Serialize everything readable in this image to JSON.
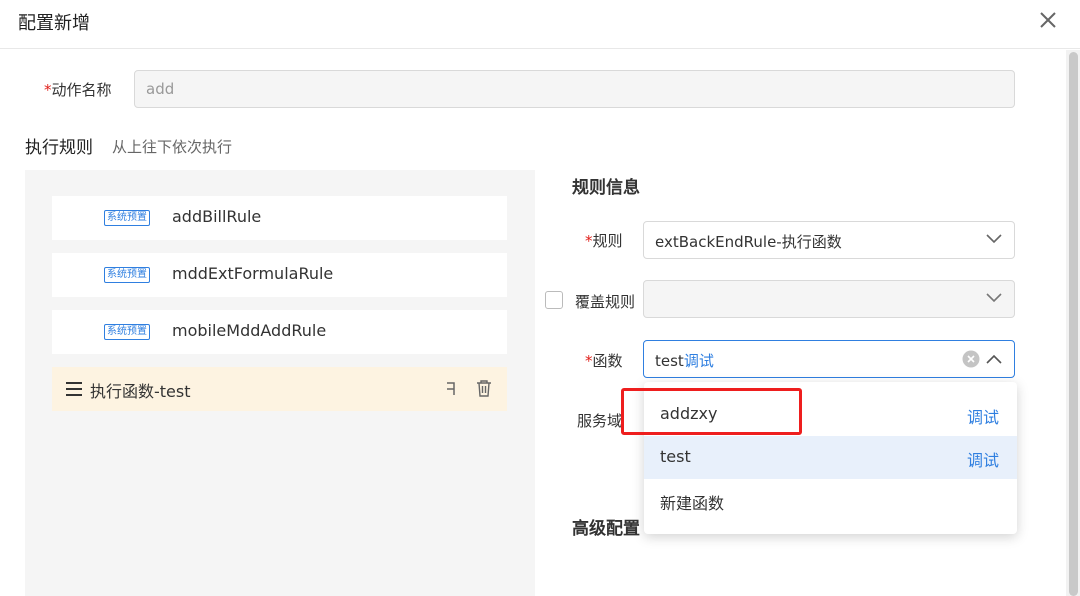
{
  "dialog": {
    "title": "配置新增",
    "close_icon": "close-icon"
  },
  "action_name": {
    "required_mark": "*",
    "label": "动作名称",
    "value": "add"
  },
  "exec_rules": {
    "title": "执行规则",
    "hint": "从上往下依次执行"
  },
  "rules": [
    {
      "tag": "系统预置",
      "name": "addBillRule"
    },
    {
      "tag": "系统预置",
      "name": "mddExtFormulaRule"
    },
    {
      "tag": "系统预置",
      "name": "mobileMddAddRule"
    }
  ],
  "selected_rule": {
    "name": "执行函数-test",
    "menu_icon": "menu-icon",
    "copy_icon": "copy-icon",
    "delete_icon": "trash-icon"
  },
  "rule_info": {
    "title": "规则信息",
    "rule_label": "规则",
    "rule_value": "extBackEndRule-执行函数",
    "override_label": "覆盖规则",
    "func_label": "函数",
    "func_value_main": "test",
    "func_value_link": "调试",
    "service_label": "服务域"
  },
  "dropdown_options": [
    {
      "name": "addzxy",
      "action": "调试"
    },
    {
      "name": "test",
      "action": "调试"
    },
    {
      "name": "新建函数",
      "action": ""
    }
  ],
  "advanced": {
    "title": "高级配置"
  },
  "colors": {
    "accent": "#2f7fe0",
    "required": "#e0201b",
    "highlight_box": "#ee1e1e",
    "selected_bg": "#fdf3e1"
  }
}
